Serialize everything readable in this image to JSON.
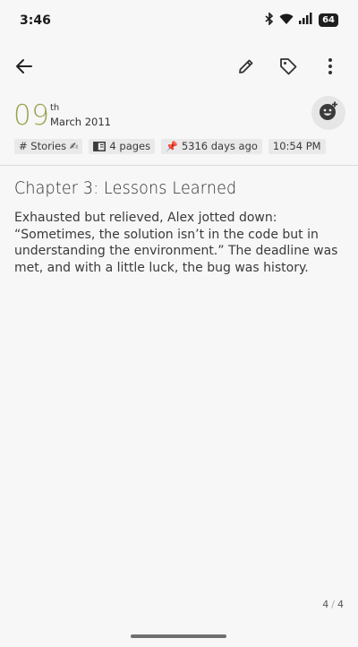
{
  "status_bar": {
    "time": "3:46",
    "battery_level": "64",
    "icons": [
      "bluetooth-icon",
      "wifi-icon",
      "signal-icon",
      "battery-icon"
    ]
  },
  "toolbar": {
    "icons": [
      "back-arrow-icon",
      "pencil-icon",
      "tag-icon",
      "more-vert-icon"
    ]
  },
  "entry": {
    "day": "09",
    "day_suffix": "th",
    "month_year": "March 2011",
    "title": "Chapter 3: Lessons Learned",
    "body": "Exhausted but relieved, Alex jotted down: “Sometimes, the solution isn’t in the code but in understanding the environment.” The deadline was met, and with a little luck, the bug was history."
  },
  "chips": {
    "tag": "# Stories ✍",
    "pages": "4 pages",
    "age_icon": "📌",
    "age": "5316 days ago",
    "time": "10:54 PM"
  },
  "pagination": {
    "current": "4",
    "separator": "/",
    "total": "4"
  },
  "colors": {
    "accent_day": "#9aa24f",
    "background": "#f7f7f7",
    "chip_bg": "#e9e9e9"
  }
}
